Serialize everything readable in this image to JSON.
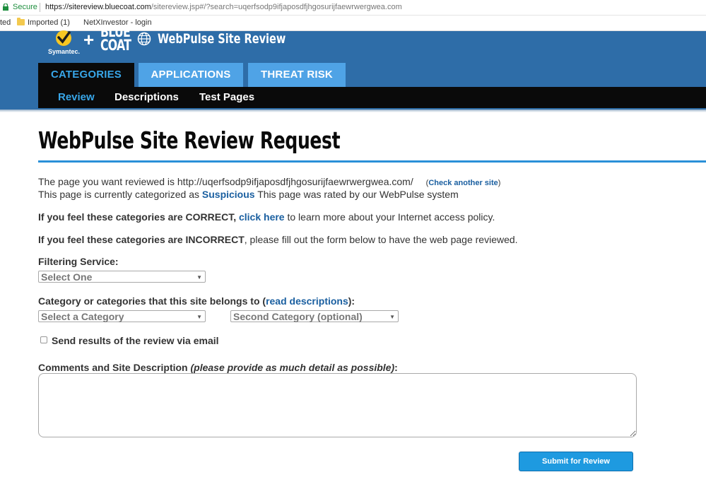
{
  "browser": {
    "secure_label": "Secure",
    "url_host": "https://sitereview.bluecoat.com",
    "url_rest": "/sitereview.jsp#/?search=uqerfsodp9ifjaposdfjhgosurijfaewrwergwea.com"
  },
  "bookmarks": {
    "items": [
      {
        "label": "ted"
      },
      {
        "label": "Imported (1)"
      },
      {
        "label": "NetXInvestor - login"
      }
    ]
  },
  "header": {
    "symantec_text": "Symantec.",
    "plus": "+",
    "bluecoat_line1": "BLUE",
    "bluecoat_line2": "COAT",
    "title": "WebPulse Site Review",
    "tabs": [
      {
        "label": "CATEGORIES"
      },
      {
        "label": "APPLICATIONS"
      },
      {
        "label": "THREAT RISK"
      }
    ],
    "subnav": [
      {
        "label": "Review"
      },
      {
        "label": "Descriptions"
      },
      {
        "label": "Test Pages"
      }
    ]
  },
  "main": {
    "title": "WebPulse Site Review Request",
    "reviewed_prefix": "The page you want reviewed is http://uqerfsodp9ifjaposdfjhgosurijfaewrwergwea.com/",
    "check_open": "(",
    "check_link": "Check another site",
    "check_close": ")",
    "categorized_prefix": "This page is currently categorized as",
    "category": "Suspicious",
    "categorized_suffix": "This page was rated by our WebPulse system",
    "correct_prefix": "If you feel these categories are CORRECT,",
    "correct_link": "click here",
    "correct_suffix": "to learn more about your Internet access policy.",
    "incorrect_prefix": "If you feel these categories are INCORRECT",
    "incorrect_suffix": ", please fill out the form below to have the web page reviewed.",
    "filtering_label": "Filtering Service:",
    "filtering_select": "Select One",
    "category_label_prefix": "Category or categories that this site belongs to (",
    "category_label_link": "read descriptions",
    "category_label_suffix": "):",
    "category_select_1": "Select a Category",
    "category_select_2": "Second Category (optional)",
    "email_label": "Send results of the review via email",
    "comments_label": "Comments and Site Description",
    "comments_hint": "(please provide as much detail as possible)",
    "comments_colon": ":",
    "submit_label": "Submit for Review"
  },
  "colors": {
    "header_blue": "#2e6da8",
    "tab_light_blue": "#4fa3e6",
    "active_tab_text": "#38a6e8",
    "link_blue": "#1a5fa0",
    "submit_blue": "#1e9ae0"
  }
}
